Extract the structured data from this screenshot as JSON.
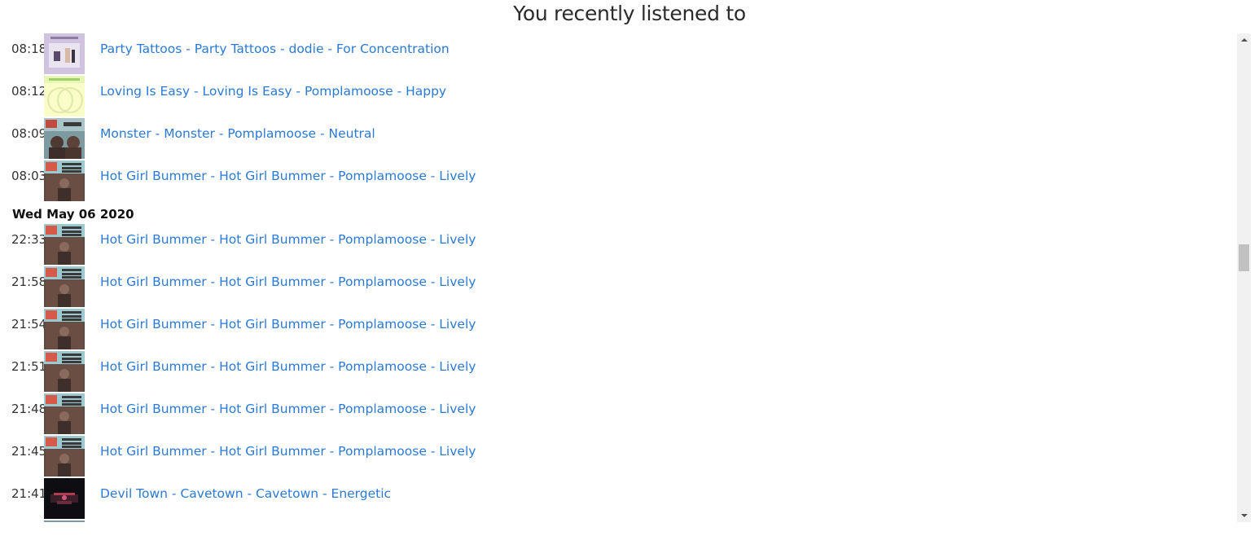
{
  "header": {
    "title": "You recently listened to"
  },
  "history": {
    "first_group": [
      {
        "time": "08:18",
        "title": "Party Tattoos - Party Tattoos - dodie - For Concentration",
        "cover": "dodie-cover"
      },
      {
        "time": "08:12",
        "title": "Loving Is Easy - Loving Is Easy - Pomplamoose - Happy",
        "cover": "pomplamoose-loving-cover"
      },
      {
        "time": "08:09",
        "title": "Monster - Monster - Pomplamoose - Neutral",
        "cover": "pomplamoose-monster-cover"
      },
      {
        "time": "08:03",
        "title": "Hot Girl Bummer - Hot Girl Bummer - Pomplamoose - Lively",
        "cover": "pomplamoose-hgb-cover"
      }
    ],
    "second_group_date": "Wed May 06 2020",
    "second_group": [
      {
        "time": "22:33",
        "title": "Hot Girl Bummer - Hot Girl Bummer - Pomplamoose - Lively",
        "cover": "pomplamoose-hgb-cover"
      },
      {
        "time": "21:58",
        "title": "Hot Girl Bummer - Hot Girl Bummer - Pomplamoose - Lively",
        "cover": "pomplamoose-hgb-cover"
      },
      {
        "time": "21:54",
        "title": "Hot Girl Bummer - Hot Girl Bummer - Pomplamoose - Lively",
        "cover": "pomplamoose-hgb-cover"
      },
      {
        "time": "21:51",
        "title": "Hot Girl Bummer - Hot Girl Bummer - Pomplamoose - Lively",
        "cover": "pomplamoose-hgb-cover"
      },
      {
        "time": "21:48",
        "title": "Hot Girl Bummer - Hot Girl Bummer - Pomplamoose - Lively",
        "cover": "pomplamoose-hgb-cover"
      },
      {
        "time": "21:45",
        "title": "Hot Girl Bummer - Hot Girl Bummer - Pomplamoose - Lively",
        "cover": "pomplamoose-hgb-cover"
      },
      {
        "time": "21:41",
        "title": "Devil Town - Cavetown - Cavetown - Energetic",
        "cover": "cavetown-cover"
      }
    ]
  },
  "colors": {
    "link": "#2a7ad6",
    "text": "#333333"
  }
}
